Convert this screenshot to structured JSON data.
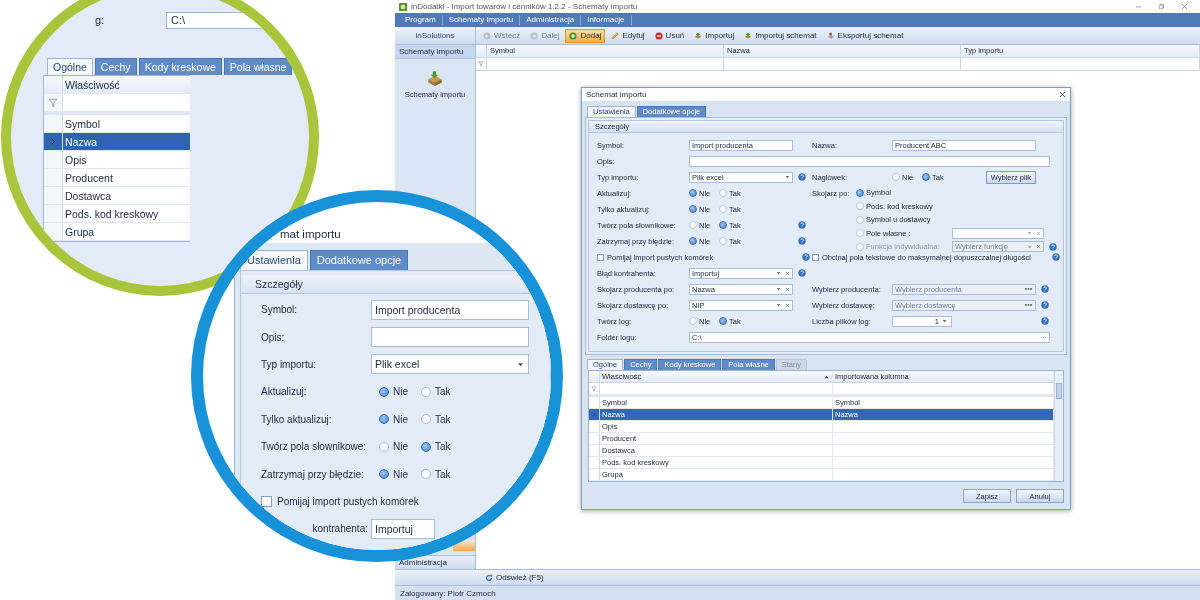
{
  "window": {
    "title": "inDodatki - Import towarów i cenników 1.2.2 - Schematy importu"
  },
  "menu": [
    "Program",
    "Schematy importu",
    "Administracja",
    "Informacje"
  ],
  "toolbar": {
    "brand": "inSolutions",
    "buttons": [
      {
        "label": "Wstecz",
        "kind": "back",
        "disabled": true,
        "highlighted": false
      },
      {
        "label": "Dalej",
        "kind": "forward",
        "disabled": true,
        "highlighted": false
      },
      {
        "label": "Dodaj",
        "kind": "add",
        "disabled": false,
        "highlighted": true
      },
      {
        "label": "Edytuj",
        "kind": "edit",
        "disabled": false,
        "highlighted": false
      },
      {
        "label": "Usuń",
        "kind": "delete",
        "disabled": false,
        "highlighted": false
      },
      {
        "label": "Importuj",
        "kind": "import",
        "disabled": false,
        "highlighted": false
      },
      {
        "label": "Importuj schemat",
        "kind": "import",
        "disabled": false,
        "highlighted": false
      },
      {
        "label": "Eksportuj schemat",
        "kind": "export",
        "disabled": false,
        "highlighted": false
      }
    ]
  },
  "sidebar": {
    "header": "Schematy importu",
    "items": [
      {
        "label": "Schematy importu"
      }
    ],
    "nav": [
      {
        "selected": true
      },
      {
        "label": "Administracja",
        "selected": false
      }
    ]
  },
  "table": {
    "columns": [
      "Symbol",
      "Nazwa",
      "Typ importu"
    ]
  },
  "dialog": {
    "title": "Schemat importu",
    "tabs": [
      {
        "label": "Ustawienia",
        "selected": true
      },
      {
        "label": "Dodatkowe opcje",
        "selected": false
      }
    ],
    "group": "Szczegóły",
    "rows": [
      {
        "left": {
          "label": "Symbol:",
          "kind": "text",
          "value": "Import producenta"
        },
        "right": {
          "label": "Nazwa:",
          "kind": "text",
          "value": "Producent ABC"
        }
      },
      {
        "full": {
          "label": "Opis:",
          "kind": "text"
        }
      },
      {
        "left": {
          "label": "Typ importu:",
          "kind": "dropdown",
          "value": "Plik excel",
          "help": true
        },
        "right": {
          "label": "Nagłówek:",
          "kind": "radio",
          "options": [
            {
              "label": "Nie",
              "selected": false
            },
            {
              "label": "Tak",
              "selected": true
            }
          ],
          "button": "Wybierz plik"
        }
      },
      {
        "left": {
          "label": "Aktualizuj:",
          "kind": "radio",
          "options": [
            {
              "label": "Nie",
              "selected": true
            },
            {
              "label": "Tak",
              "selected": false
            }
          ]
        },
        "right": {
          "label": "Skojarz po:",
          "kind": "radio_list",
          "options": [
            {
              "label": "Symbol",
              "selected": true,
              "disabled": false
            },
            {
              "label": "Pods. kod kreskowy",
              "selected": false,
              "disabled": false
            },
            {
              "label": "Symbol u dostawcy",
              "selected": false,
              "disabled": false
            },
            {
              "label": "Pole własne :",
              "selected": false,
              "disabled": false,
              "combo": {
                "disabled": false
              }
            },
            {
              "label": "Funkcja indywidualna:",
              "selected": false,
              "disabled": true,
              "combo": {
                "placeholder": "Wybierz funkcję",
                "disabled": true
              },
              "help": true
            }
          ]
        }
      },
      {
        "left": {
          "label": "Tylko aktualizuj:",
          "kind": "radio",
          "options": [
            {
              "label": "Nie",
              "selected": true
            },
            {
              "label": "Tak",
              "selected": false
            }
          ]
        }
      },
      {
        "left": {
          "label": "Twórz pola słownikowe:",
          "kind": "radio",
          "options": [
            {
              "label": "Nie",
              "selected": false
            },
            {
              "label": "Tak",
              "selected": true
            }
          ],
          "help": true
        }
      },
      {
        "left": {
          "label": "Zatrzymaj przy błędzie:",
          "kind": "radio",
          "options": [
            {
              "label": "Nie",
              "selected": true
            },
            {
              "label": "Tak",
              "selected": false
            }
          ],
          "help": true
        }
      },
      {
        "left": {
          "label": "Pomijaj import pustych komórek",
          "kind": "checkbox",
          "checked": false,
          "help": true
        },
        "right": {
          "label": "Obcinaj pola tekstowe do maksymalnej dopuszczalnej długości",
          "kind": "checkbox",
          "checked": false,
          "help": true
        }
      },
      {
        "left": {
          "label": "Błąd kontrahenta:",
          "kind": "combo",
          "value": "Importuj",
          "help": true
        }
      },
      {
        "left": {
          "label": "Skojarz producenta po:",
          "kind": "combo",
          "value": "Nazwa"
        },
        "right": {
          "label": "Wybierz producenta:",
          "kind": "lookup",
          "placeholder": "Wybierz producenta",
          "disabled": true,
          "help": true
        }
      },
      {
        "left": {
          "label": "Skojarz dostawcę po:",
          "kind": "combo",
          "value": "NIP"
        },
        "right": {
          "label": "Wybierz dostawcę:",
          "kind": "lookup",
          "placeholder": "Wybierz dostawcę",
          "disabled": true,
          "help": true
        }
      },
      {
        "left": {
          "label": "Twórz log:",
          "kind": "radio",
          "options": [
            {
              "label": "Nie",
              "selected": false
            },
            {
              "label": "Tak",
              "selected": true
            }
          ]
        },
        "right": {
          "label": "Liczba plików log:",
          "kind": "spin",
          "value": "1",
          "help": true
        }
      },
      {
        "full": {
          "label": "Folder logu:",
          "kind": "path",
          "value": "C:\\"
        }
      }
    ],
    "grid_tabs": [
      {
        "label": "Ogólne",
        "selected": true,
        "disabled": false
      },
      {
        "label": "Cechy",
        "selected": false,
        "disabled": false
      },
      {
        "label": "Kody kreskowe",
        "selected": false,
        "disabled": false
      },
      {
        "label": "Pola własne",
        "selected": false,
        "disabled": false
      },
      {
        "label": "Stany",
        "selected": false,
        "disabled": true
      }
    ],
    "grid": {
      "columns": [
        "Właściwość",
        "Importowana kolumna"
      ],
      "rows": [
        {
          "cells": [
            "Symbol",
            "Symbol"
          ],
          "selected": false
        },
        {
          "cells": [
            "Nazwa",
            "Nazwa"
          ],
          "selected": true
        },
        {
          "cells": [
            "Opis"
          ],
          "selected": false
        },
        {
          "cells": [
            "Producent"
          ],
          "selected": false
        },
        {
          "cells": [
            "Dostawca"
          ],
          "selected": false
        },
        {
          "cells": [
            "Pods. kod kreskowy"
          ],
          "selected": false
        },
        {
          "cells": [
            "Grupa"
          ],
          "selected": false
        }
      ]
    },
    "buttons": [
      "Zapisz",
      "Anuluj"
    ]
  },
  "refresh_button": "Odśwież (F5)",
  "status_bar": "Zalogowany: Piotr Czmoch",
  "magnifiers": [
    {
      "kind": "grid_detail",
      "field_label": "g:",
      "field_value": "C:\\",
      "tabs": [
        {
          "label": "Ogólne",
          "selected": true
        },
        {
          "label": "Cechy",
          "selected": false
        },
        {
          "label": "Kody kreskowe",
          "selected": false
        },
        {
          "label": "Pola własne",
          "selected": false
        }
      ],
      "column": "Właściwość",
      "rows": [
        {
          "label": "Symbol",
          "selected": false
        },
        {
          "label": "Nazwa",
          "selected": true
        },
        {
          "label": "Opis",
          "selected": false
        },
        {
          "label": "Producent",
          "selected": false
        },
        {
          "label": "Dostawca",
          "selected": false
        },
        {
          "label": "Pods. kod kreskowy",
          "selected": false
        },
        {
          "label": "Grupa",
          "selected": false
        }
      ]
    },
    {
      "kind": "form_detail",
      "title": "mat importu",
      "tabs": [
        {
          "label": "Ustawienia",
          "selected": true
        },
        {
          "label": "Dodatkowe opcje",
          "selected": false
        }
      ],
      "group": "Szczegóły",
      "rows": [
        {
          "label": "Symbol:",
          "kind": "text",
          "value": "Import producenta"
        },
        {
          "label": "Opis:",
          "kind": "text"
        },
        {
          "label": "Typ importu:",
          "kind": "dropdown",
          "value": "Plik excel"
        },
        {
          "label": "Aktualizuj:",
          "kind": "radio",
          "options": [
            {
              "label": "Nie",
              "selected": true
            },
            {
              "label": "Tak",
              "selected": false
            }
          ]
        },
        {
          "label": "Tylko aktualizuj:",
          "kind": "radio",
          "options": [
            {
              "label": "Nie",
              "selected": true
            },
            {
              "label": "Tak",
              "selected": false
            }
          ]
        },
        {
          "label": "Twórz pola słownikowe:",
          "kind": "radio",
          "options": [
            {
              "label": "Nie",
              "selected": false
            },
            {
              "label": "Tak",
              "selected": true
            }
          ]
        },
        {
          "label": "Zatrzymaj przy błędzie:",
          "kind": "radio",
          "options": [
            {
              "label": "Nie",
              "selected": true
            },
            {
              "label": "Tak",
              "selected": false
            }
          ]
        },
        {
          "label": "Pomijaj import pustych komórek",
          "kind": "checkbox",
          "checked": false
        },
        {
          "label": "kontrahenta:",
          "kind": "combo",
          "value": "Importuj"
        }
      ]
    }
  ]
}
